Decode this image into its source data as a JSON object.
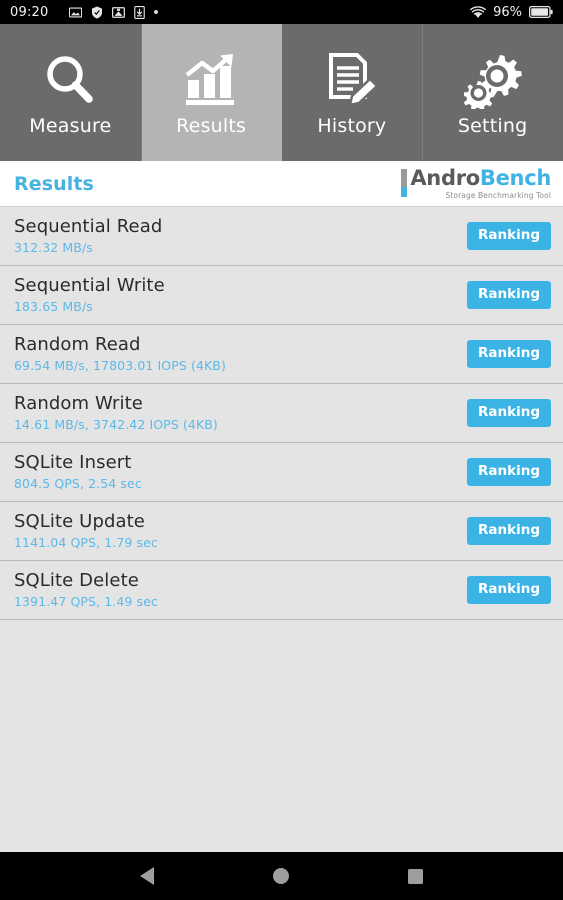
{
  "statusbar": {
    "clock": "09:20",
    "battery_percent": "96%",
    "icons": [
      "image-icon",
      "shield-icon",
      "photo-mail-icon",
      "download-icon",
      "dot-icon"
    ],
    "right_icons": [
      "wifi-icon",
      "battery-icon"
    ]
  },
  "tabs": [
    {
      "label": "Measure",
      "icon": "magnifier-icon",
      "active": false
    },
    {
      "label": "Results",
      "icon": "bar-chart-icon",
      "active": true
    },
    {
      "label": "History",
      "icon": "document-pencil-icon",
      "active": false
    },
    {
      "label": "Setting",
      "icon": "gears-icon",
      "active": false
    }
  ],
  "header": {
    "title": "Results",
    "logo_primary": "Andro",
    "logo_secondary": "Bench",
    "logo_subtitle": "Storage Benchmarking Tool"
  },
  "rows": [
    {
      "title": "Sequential Read",
      "value": "312.32 MB/s",
      "button": "Ranking"
    },
    {
      "title": "Sequential Write",
      "value": "183.65 MB/s",
      "button": "Ranking"
    },
    {
      "title": "Random Read",
      "value": "69.54 MB/s, 17803.01 IOPS (4KB)",
      "button": "Ranking"
    },
    {
      "title": "Random Write",
      "value": "14.61 MB/s, 3742.42 IOPS (4KB)",
      "button": "Ranking"
    },
    {
      "title": "SQLite Insert",
      "value": "804.5 QPS, 2.54 sec",
      "button": "Ranking"
    },
    {
      "title": "SQLite Update",
      "value": "1141.04 QPS, 1.79 sec",
      "button": "Ranking"
    },
    {
      "title": "SQLite Delete",
      "value": "1391.47 QPS, 1.49 sec",
      "button": "Ranking"
    }
  ],
  "navbar": {
    "back": "back-icon",
    "home": "home-icon",
    "recents": "recents-icon"
  },
  "colors": {
    "accent": "#3bb4e5",
    "value_text": "#5cb9e8",
    "tab_inactive": "#6b6b6b",
    "tab_active": "#b4b4b4",
    "list_bg": "#e4e4e4"
  }
}
